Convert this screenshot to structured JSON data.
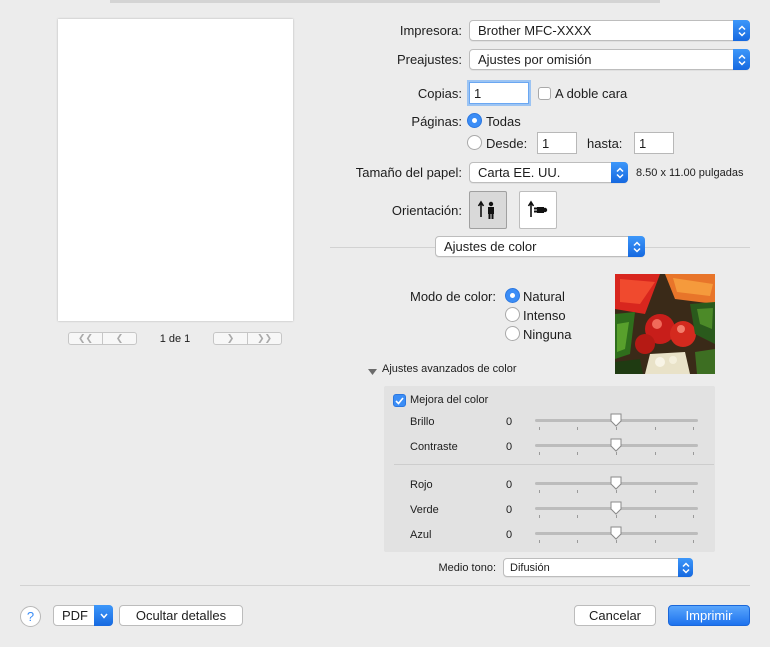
{
  "preview": {
    "page_info": "1 de 1"
  },
  "printer": {
    "label": "Impresora:",
    "value": "Brother MFC-XXXX"
  },
  "presets": {
    "label": "Preajustes:",
    "value": "Ajustes por omisión"
  },
  "copies": {
    "label": "Copias:",
    "value": "1",
    "duplex_label": "A doble cara"
  },
  "pages": {
    "label": "Páginas:",
    "all_label": "Todas",
    "from_label": "Desde:",
    "from_value": "1",
    "to_label": "hasta:",
    "to_value": "1"
  },
  "paper": {
    "label": "Tamaño del papel:",
    "value": "Carta EE. UU.",
    "dimensions": "8.50 x 11.00 pulgadas"
  },
  "orientation": {
    "label": "Orientación:"
  },
  "section": {
    "value": "Ajustes de color"
  },
  "color_mode": {
    "label": "Modo de color:",
    "options": [
      "Natural",
      "Intenso",
      "Ninguna"
    ],
    "selected": "Natural"
  },
  "advanced": {
    "title": "Ajustes avanzados de color",
    "enhance_label": "Mejora del color",
    "enhance_checked": true,
    "sliders": [
      {
        "label": "Brillo",
        "value": "0"
      },
      {
        "label": "Contraste",
        "value": "0"
      },
      {
        "label": "Rojo",
        "value": "0"
      },
      {
        "label": "Verde",
        "value": "0"
      },
      {
        "label": "Azul",
        "value": "0"
      }
    ]
  },
  "halftone": {
    "label": "Medio tono:",
    "value": "Difusión"
  },
  "footer": {
    "help": "?",
    "pdf": "PDF",
    "hide_details": "Ocultar detalles",
    "cancel": "Cancelar",
    "print": "Imprimir"
  },
  "colors": {
    "accent": "#3b8df6",
    "background": "#ececec"
  }
}
